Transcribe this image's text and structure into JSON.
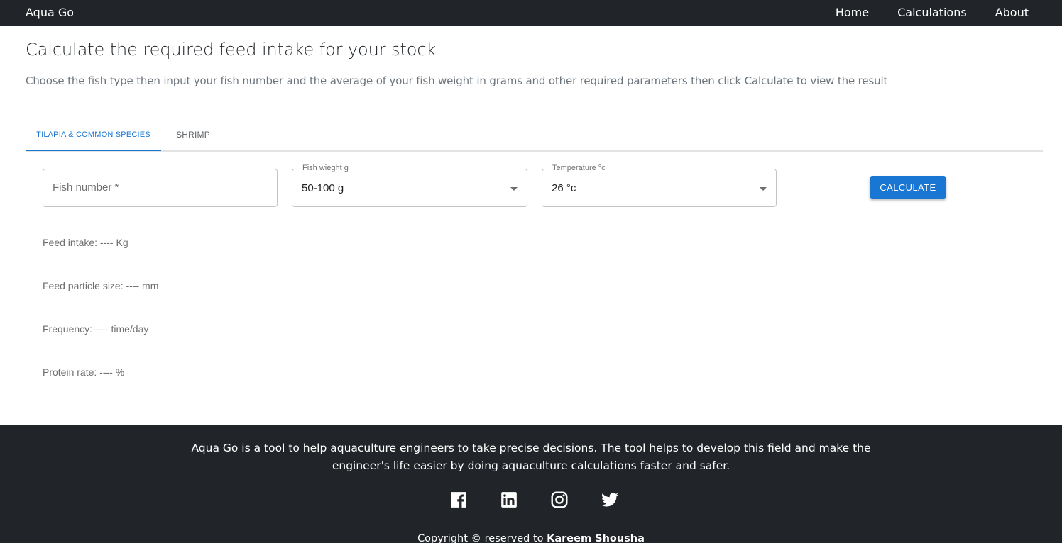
{
  "navbar": {
    "brand": "Aqua Go",
    "links": [
      "Home",
      "Calculations",
      "About"
    ]
  },
  "header": {
    "title": "Calculate the required feed intake for your stock",
    "description": "Choose the fish type then input your fish number and the average of your fish weight in grams and other required parameters then click Calculate to view the result"
  },
  "tabs": [
    "TILAPIA & COMMON SPECIES",
    "SHRIMP"
  ],
  "form": {
    "fish_number_placeholder": "Fish number *",
    "fish_weight_label": "Fish wieght g",
    "fish_weight_value": "50-100 g",
    "temperature_label": "Temperature °c",
    "temperature_value": "26 °c",
    "calculate_label": "CALCULATE"
  },
  "results": {
    "feed_intake": "Feed intake: ---- Kg",
    "particle_size": "Feed particle size: ---- mm",
    "frequency": "Frequency: ---- time/day",
    "protein_rate": "Protein rate: ---- %"
  },
  "footer": {
    "about": "Aqua Go is a tool to help aquaculture engineers to take precise decisions. The tool helps to develop this field and make the engineer's life easier by doing aquaculture calculations faster and safer.",
    "copyright_prefix": "Copyright © reserved to ",
    "copyright_name": "Kareem Shousha",
    "social_icons": [
      "facebook-icon",
      "linkedin-icon",
      "instagram-icon",
      "twitter-icon"
    ]
  },
  "colors": {
    "navbar_bg": "#212529",
    "accent": "#1976d2",
    "muted_text": "#6c757d"
  }
}
